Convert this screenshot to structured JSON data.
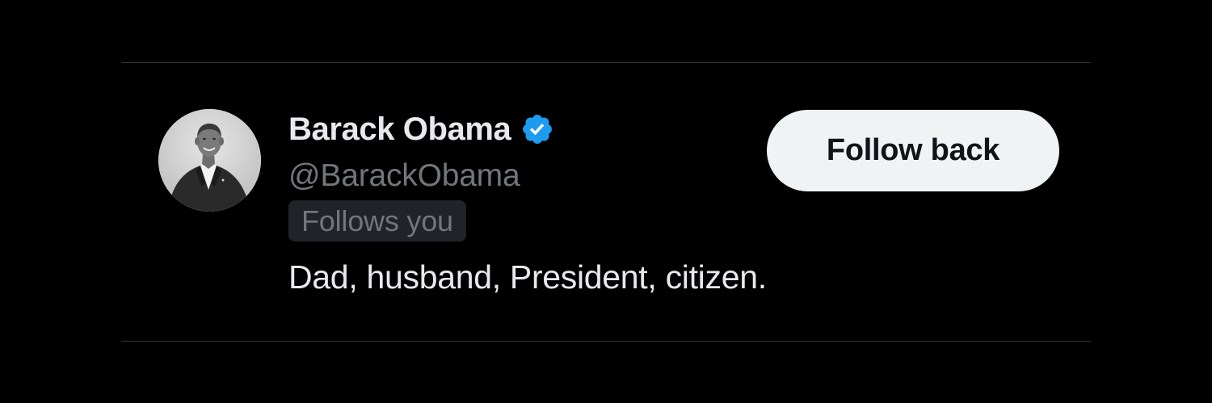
{
  "user": {
    "display_name": "Barack Obama",
    "handle": "@BarackObama",
    "follows_you_label": "Follows you",
    "bio": "Dad, husband, President, citizen.",
    "verified": true,
    "verified_icon": "verified-badge-icon",
    "avatar": "avatar-photo"
  },
  "actions": {
    "follow_back_label": "Follow back"
  },
  "colors": {
    "background": "#000000",
    "primary_text": "#e7e9ea",
    "secondary_text": "#71767b",
    "verified_blue": "#1d9bf0",
    "button_bg": "#eff3f4",
    "button_text": "#0f1419",
    "badge_bg": "#202327",
    "divider": "#2f3336"
  }
}
